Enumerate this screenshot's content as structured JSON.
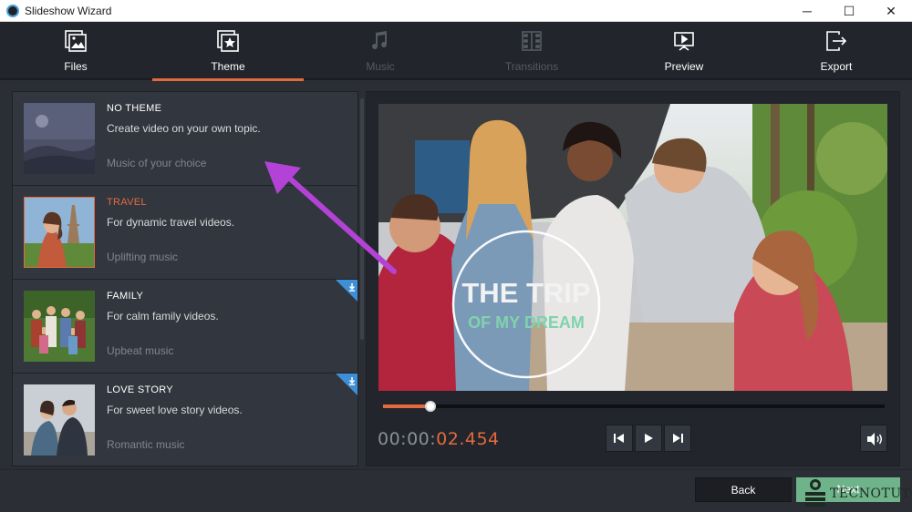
{
  "window": {
    "title": "Slideshow Wizard",
    "controls": {
      "minimize": "─",
      "maximize": "☐",
      "close": "✕"
    }
  },
  "tabs": [
    {
      "label": "Files",
      "icon": "files-icon",
      "state": "enabled"
    },
    {
      "label": "Theme",
      "icon": "theme-icon",
      "state": "active"
    },
    {
      "label": "Music",
      "icon": "music-icon",
      "state": "disabled"
    },
    {
      "label": "Transitions",
      "icon": "transitions-icon",
      "state": "disabled"
    },
    {
      "label": "Preview",
      "icon": "preview-icon",
      "state": "enabled"
    },
    {
      "label": "Export",
      "icon": "export-icon",
      "state": "enabled"
    }
  ],
  "themes": [
    {
      "title": "NO THEME",
      "description": "Create video on your own topic.",
      "music": "Music of your choice",
      "selected": false,
      "download": false
    },
    {
      "title": "TRAVEL",
      "description": "For dynamic travel videos.",
      "music": "Uplifting music",
      "selected": true,
      "download": false
    },
    {
      "title": "FAMILY",
      "description": "For calm family videos.",
      "music": "Upbeat music",
      "selected": false,
      "download": true
    },
    {
      "title": "LOVE STORY",
      "description": "For sweet love story videos.",
      "music": "Romantic music",
      "selected": false,
      "download": true
    }
  ],
  "preview": {
    "title_overlay_line1": "THE TRIP",
    "title_overlay_line2": "OF MY DREAM",
    "progress": 0.095,
    "time_dim": "00:00:",
    "time_active": "02.454"
  },
  "footer": {
    "back_label": "Back",
    "next_label": "Next",
    "watermark": "TECNOTUTO"
  },
  "colors": {
    "accent": "#e36a3e",
    "next_button": "#6fb38a",
    "arrow": "#b243d6",
    "download_badge": "#3f8fd6"
  }
}
